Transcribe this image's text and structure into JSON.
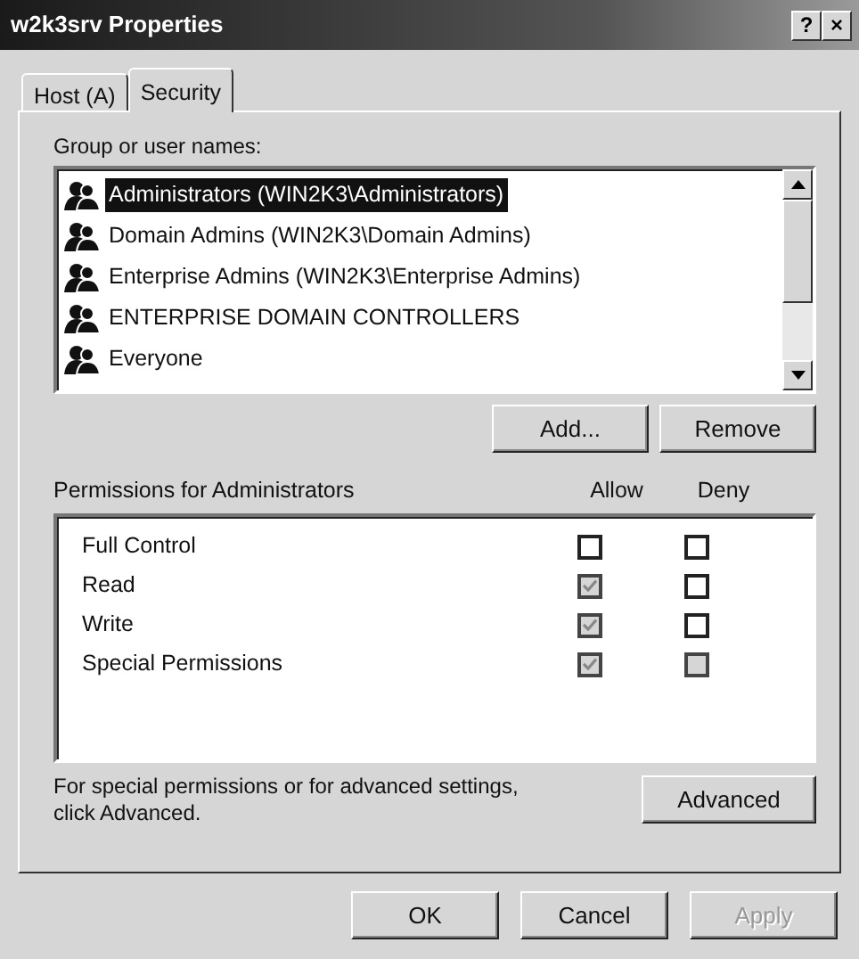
{
  "window": {
    "title": "w2k3srv Properties",
    "title_buttons": [
      "?",
      "×"
    ]
  },
  "tabs": [
    {
      "label": "Host (A)",
      "selected": false
    },
    {
      "label": "Security",
      "selected": true
    }
  ],
  "group_label": "Group or user names:",
  "users": [
    {
      "name": "Administrators (WIN2K3\\Administrators)",
      "selected": true
    },
    {
      "name": "Domain Admins (WIN2K3\\Domain Admins)",
      "selected": false
    },
    {
      "name": "Enterprise Admins (WIN2K3\\Enterprise Admins)",
      "selected": false
    },
    {
      "name": "ENTERPRISE DOMAIN CONTROLLERS",
      "selected": false
    },
    {
      "name": "Everyone",
      "selected": false
    }
  ],
  "user_buttons": [
    "Add...",
    "Remove"
  ],
  "permissions_label": "Permissions for Administrators",
  "columns": [
    "Allow",
    "Deny"
  ],
  "permissions": [
    {
      "name": "Full Control",
      "allow": {
        "checked": false,
        "disabled": false
      },
      "deny": {
        "checked": false,
        "disabled": false
      }
    },
    {
      "name": "Read",
      "allow": {
        "checked": true,
        "disabled": true
      },
      "deny": {
        "checked": false,
        "disabled": false
      }
    },
    {
      "name": "Write",
      "allow": {
        "checked": true,
        "disabled": true
      },
      "deny": {
        "checked": false,
        "disabled": false
      }
    },
    {
      "name": "Special Permissions",
      "allow": {
        "checked": true,
        "disabled": true
      },
      "deny": {
        "checked": false,
        "disabled": true
      }
    }
  ],
  "advanced_note": "For special permissions or for advanced settings, click Advanced.",
  "advanced_button": "Advanced",
  "buttons": [
    {
      "label": "OK",
      "disabled": false
    },
    {
      "label": "Cancel",
      "disabled": false
    },
    {
      "label": "Apply",
      "disabled": true
    }
  ]
}
